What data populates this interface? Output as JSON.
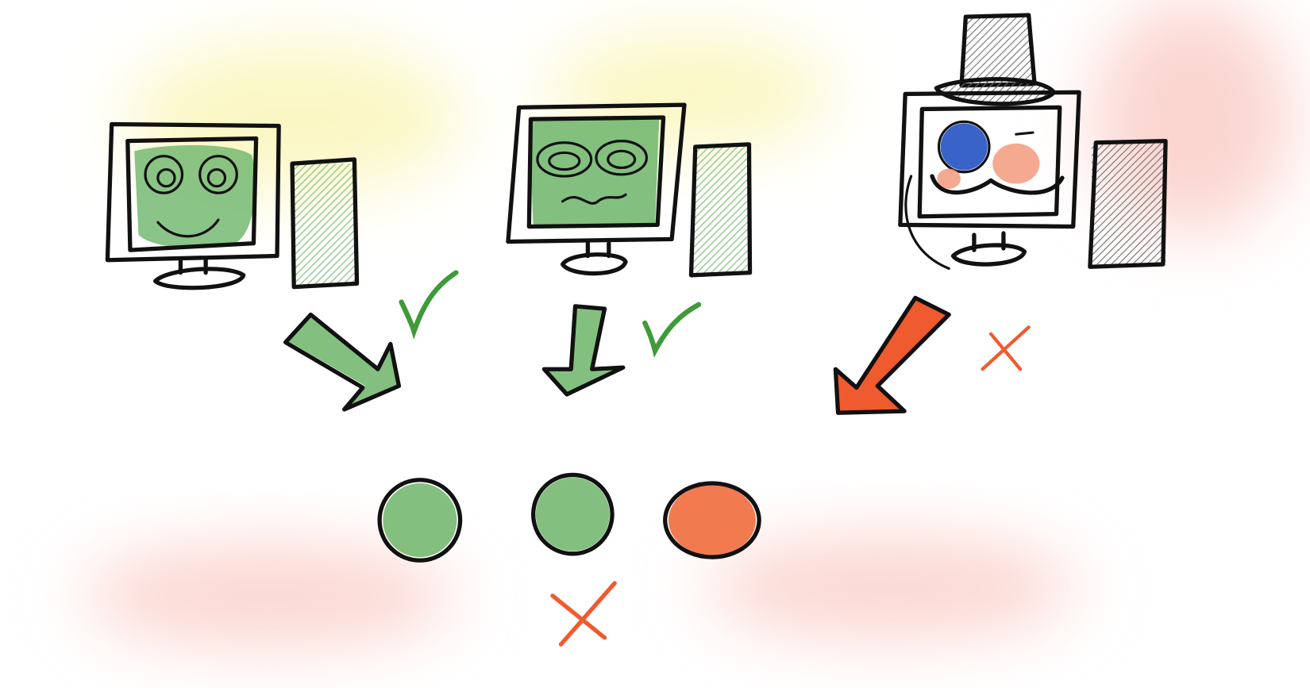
{
  "colors": {
    "background": "#ffffff",
    "ink": "#111111",
    "good_green": "#6db56a",
    "check_green": "#3f9a3a",
    "bad_orange": "#ef5a2f",
    "bad_circle": "#f27a4f",
    "monocle_blue": "#3a63c8",
    "blush": "#f59a7e",
    "hat_gray": "#8a8a8a",
    "glow_yellow": "#fbf7c4",
    "glow_red": "#fbd6d0"
  },
  "figures": [
    {
      "name": "happy-computer",
      "status": "accepted",
      "marker": "check-icon"
    },
    {
      "name": "worried-computer",
      "status": "accepted",
      "marker": "check-icon"
    },
    {
      "name": "fancy-computer",
      "status": "rejected",
      "marker": "cross-icon"
    }
  ],
  "results": [
    {
      "name": "green-result",
      "status": "good"
    },
    {
      "name": "green-result",
      "status": "good"
    },
    {
      "name": "orange-result",
      "status": "bad"
    }
  ],
  "result_marker": "cross-icon"
}
